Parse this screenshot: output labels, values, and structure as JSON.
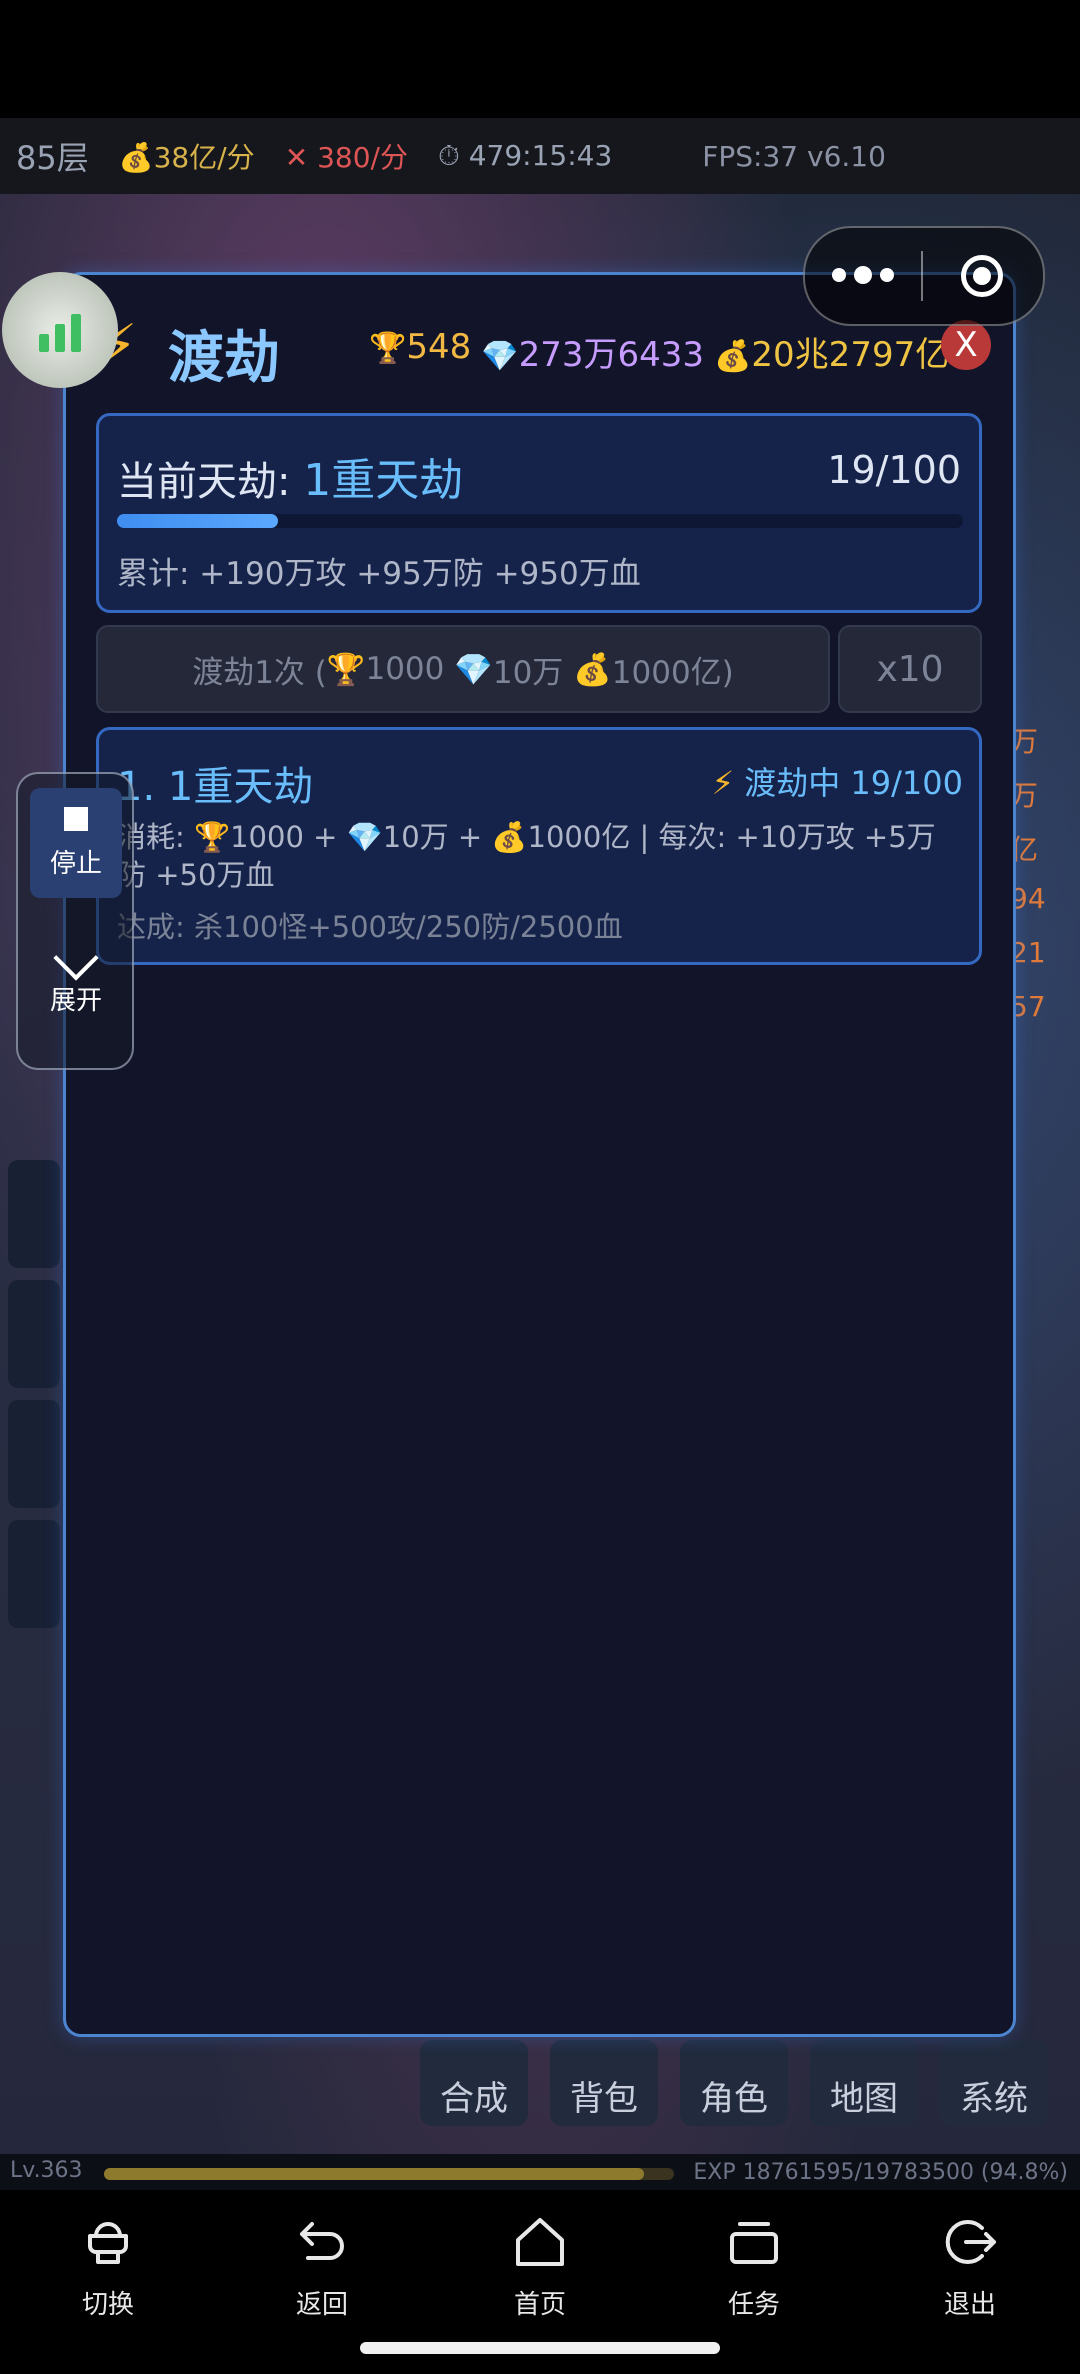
{
  "game": {
    "floor": "85层",
    "gold_rate": "38亿",
    "gold_unit": "/分",
    "atk_rate": "380",
    "atk_unit": "/分",
    "timer": "479:15:43",
    "fps": "FPS:37 v6.10",
    "bottom_buttons": [
      "合成",
      "背包",
      "角色",
      "地图",
      "系统"
    ],
    "level": "Lv.363",
    "exp_text": "EXP 18761595/19783500 (94.8%)",
    "exp_progress": 0.948,
    "right_edge": [
      "万",
      "万",
      "亿",
      "94",
      "21",
      "57"
    ]
  },
  "modal": {
    "title": "渡劫",
    "trophy": "548",
    "gems": "273万6433",
    "money": "20兆2797亿",
    "close_label": "X",
    "current": {
      "label": "当前天劫: ",
      "value": "1重天劫",
      "progress_text": "19/100",
      "progress": 0.19,
      "accum": "累计: +190万攻 +95万防 +950万血"
    },
    "tribulate_button": {
      "prefix": "渡劫1次 (",
      "trophy": "1000",
      "gem": "10万",
      "money": "1000亿)"
    },
    "x10_label": "x10",
    "item": {
      "title": "1. 1重天劫",
      "status": "渡劫中 19/100",
      "cost_prefix": "消耗: ",
      "cost_trophy": "1000 + ",
      "cost_gem": "10万 + ",
      "cost_money": "1000亿 | 每次: +10万攻 +5万防 +50万血",
      "requirement": "达成: 杀100怪+500攻/250防/2500血"
    }
  },
  "controls": {
    "stop_label": "停止",
    "expand_label": "展开"
  },
  "nav": {
    "items": [
      "切换",
      "返回",
      "首页",
      "任务",
      "退出"
    ]
  },
  "colors": {
    "accent": "#69bdfb",
    "panel_border": "#4c84cf",
    "close": "#b93838",
    "progress": "#3f8df0"
  }
}
